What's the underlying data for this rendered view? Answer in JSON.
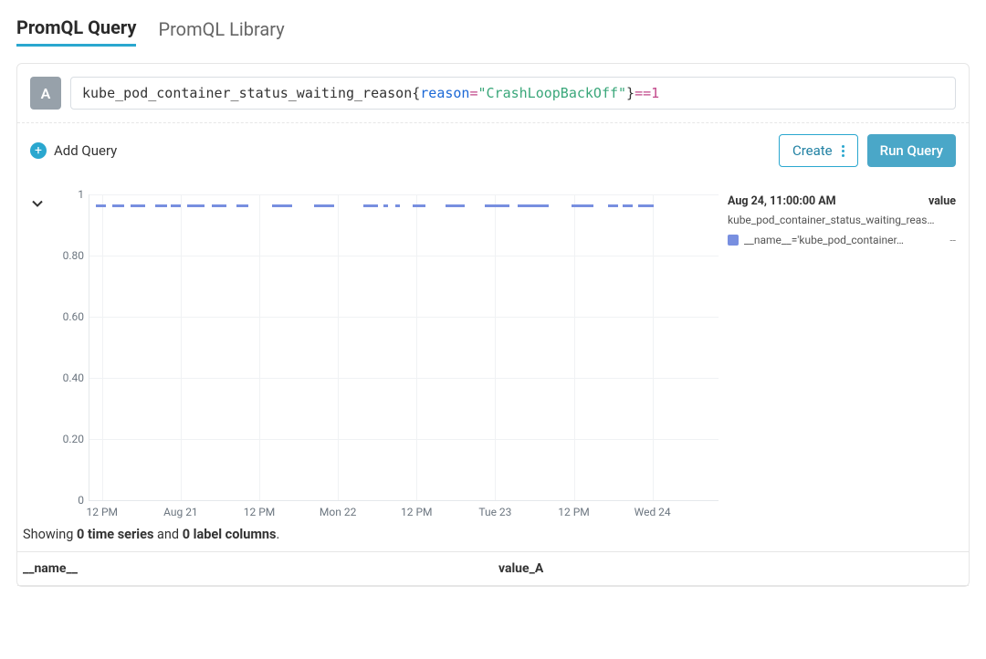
{
  "tabs": {
    "active": "PromQL Query",
    "other": "PromQL Library"
  },
  "query": {
    "badge": "A",
    "tokens": {
      "metric": "kube_pod_container_status_waiting_reason",
      "lbrace": "{",
      "label": "reason",
      "eq": "=",
      "value": "\"CrashLoopBackOff\"",
      "rbrace": "}",
      "op": " == ",
      "num": "1"
    }
  },
  "actions": {
    "add_query": "Add Query",
    "create": "Create",
    "run": "Run Query"
  },
  "legend": {
    "timestamp": "Aug 24, 11:00:00 AM",
    "value_header": "value",
    "series_name": "kube_pod_container_status_waiting_reas…",
    "item_label": "__name__='kube_pod_container…",
    "item_value": "--"
  },
  "summary": {
    "prefix": "Showing ",
    "ts": "0 time series",
    "mid": " and ",
    "lc": "0 label columns",
    "suffix": "."
  },
  "table_headers": {
    "col1": "__name__",
    "col2": "value_A"
  },
  "chart_data": {
    "type": "line",
    "title": "",
    "xlabel": "",
    "ylabel": "",
    "ylim": [
      0,
      1
    ],
    "y_ticks": [
      0,
      0.2,
      0.4,
      0.6,
      0.8,
      1
    ],
    "x_ticks": [
      "12 PM",
      "Aug 21",
      "12 PM",
      "Mon 22",
      "12 PM",
      "Tue 23",
      "12 PM",
      "Wed 24"
    ],
    "x_tick_positions_pct": [
      2,
      14.5,
      27,
      39.5,
      52,
      64.5,
      77,
      89.5
    ],
    "series": [
      {
        "name": "__name__='kube_pod_container_status_waiting_reason'",
        "color": "#788fe0",
        "segments_pct": [
          [
            1.0,
            1.6
          ],
          [
            3.6,
            1.9
          ],
          [
            6.6,
            2.2
          ],
          [
            10.5,
            1.9
          ],
          [
            12.9,
            1.6
          ],
          [
            15.5,
            2.8
          ],
          [
            19.5,
            2.2
          ],
          [
            23.3,
            1.9
          ],
          [
            29.0,
            3.2
          ],
          [
            35.7,
            3.2
          ],
          [
            43.6,
            2.2
          ],
          [
            46.8,
            0.7
          ],
          [
            48.6,
            0.7
          ],
          [
            51.4,
            2.0
          ],
          [
            56.6,
            3.0
          ],
          [
            62.9,
            3.8
          ],
          [
            68.0,
            5.0
          ],
          [
            76.6,
            3.5
          ],
          [
            82.5,
            1.6
          ],
          [
            84.8,
            1.6
          ],
          [
            87.2,
            2.5
          ]
        ]
      }
    ]
  }
}
